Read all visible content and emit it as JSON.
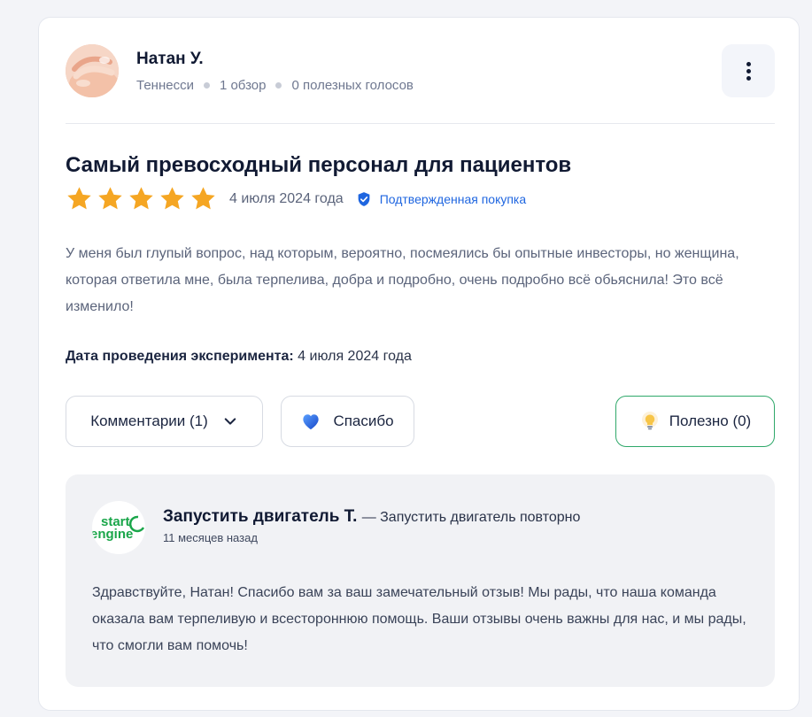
{
  "review": {
    "author": {
      "name": "Натан У.",
      "location": "Теннесси",
      "reviews_count": "1 обзор",
      "helpful_votes": "0 полезных голосов",
      "avatar_icon": "hands-photo-avatar"
    },
    "title": "Самый превосходный персонал для пациентов",
    "rating": 5,
    "rating_max": 5,
    "date": "4 июля 2024 года",
    "verified_label": "Подтвержденная покупка",
    "body": "У меня был глупый вопрос, над которым, вероятно, посмеялись бы опытные инвесторы, но женщина, которая ответила мне, была терпелива, добра и подробно, очень подробно всё обьяснила! Это всё изменило!",
    "experience_label": "Дата проведения эксперимента:",
    "experience_date": "4 июля 2024 года"
  },
  "actions": {
    "comments_label": "Комментарии (1)",
    "thanks_label": "Спасибо",
    "useful_label": "Полезно (0)"
  },
  "reply": {
    "name": "Запустить двигатель Т.",
    "role": "— Запустить двигатель повторно",
    "time": "11 месяцев назад",
    "body": "Здравствуйте, Натан! Спасибо вам за ваш замечательный отзыв! Мы рады, что наша команда оказала вам терпеливую и всестороннюю помощь. Ваши отзывы очень важны для нас, и мы рады, что смогли вам помочь!",
    "logo_text_top": "start",
    "logo_text_bottom": "engine"
  },
  "colors": {
    "star": "#f5a623",
    "verified": "#1f66e0",
    "useful_border": "#2fa86a",
    "logo_green": "#1aa64a"
  }
}
